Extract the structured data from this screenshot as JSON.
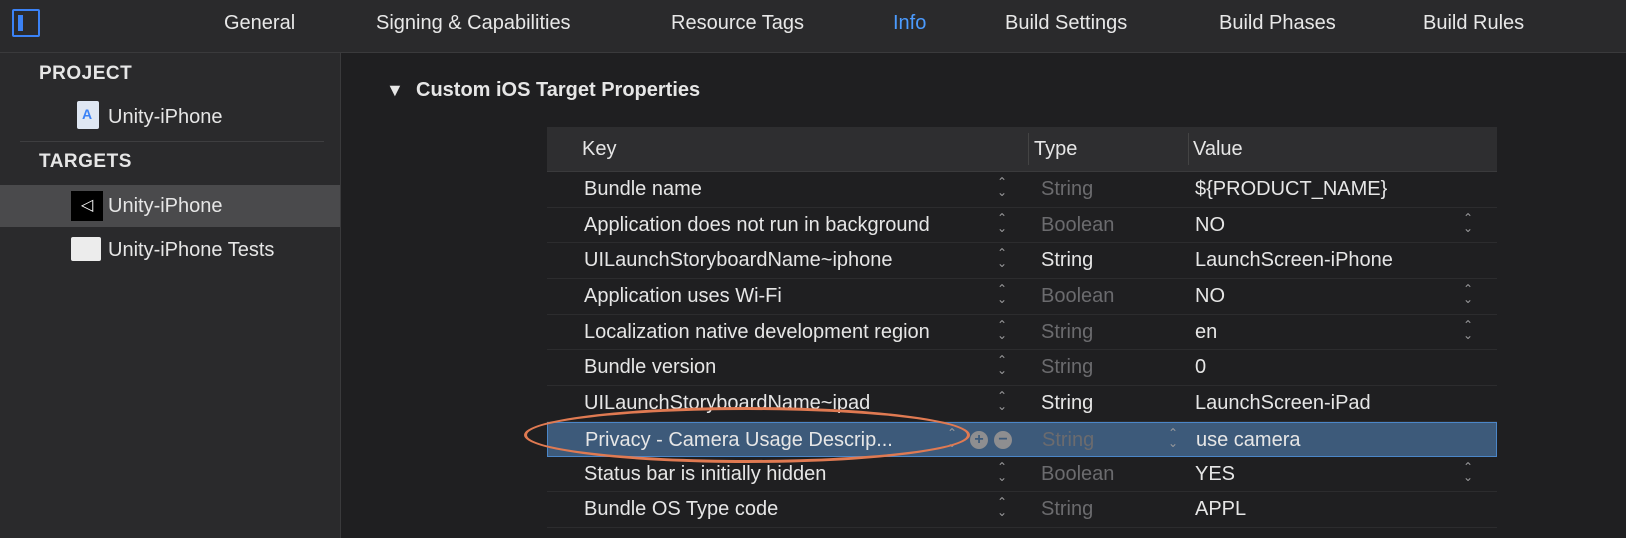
{
  "tabs": [
    {
      "label": "General",
      "active": false
    },
    {
      "label": "Signing & Capabilities",
      "active": false
    },
    {
      "label": "Resource Tags",
      "active": false
    },
    {
      "label": "Info",
      "active": true
    },
    {
      "label": "Build Settings",
      "active": false
    },
    {
      "label": "Build Phases",
      "active": false
    },
    {
      "label": "Build Rules",
      "active": false
    }
  ],
  "sidebar": {
    "project_header": "PROJECT",
    "project_item": "Unity-iPhone",
    "targets_header": "TARGETS",
    "targets": [
      {
        "label": "Unity-iPhone",
        "selected": true,
        "icon": "unity-icon"
      },
      {
        "label": "Unity-iPhone Tests",
        "selected": false,
        "icon": "test-bundle-icon"
      }
    ]
  },
  "section": {
    "title": "Custom iOS Target Properties",
    "disclosure": "▼"
  },
  "table": {
    "headers": {
      "key": "Key",
      "type": "Type",
      "value": "Value"
    },
    "rows": [
      {
        "key": "Bundle name",
        "type": "String",
        "type_dim": true,
        "value": "${PRODUCT_NAME}",
        "value_stepper": false,
        "selected": false
      },
      {
        "key": "Application does not run in background",
        "type": "Boolean",
        "type_dim": true,
        "value": "NO",
        "value_stepper": true,
        "selected": false
      },
      {
        "key": "UILaunchStoryboardName~iphone",
        "type": "String",
        "type_dim": false,
        "value": "LaunchScreen-iPhone",
        "value_stepper": false,
        "selected": false
      },
      {
        "key": "Application uses Wi-Fi",
        "type": "Boolean",
        "type_dim": true,
        "value": "NO",
        "value_stepper": true,
        "selected": false
      },
      {
        "key": "Localization native development region",
        "type": "String",
        "type_dim": true,
        "value": "en",
        "value_stepper": true,
        "selected": false
      },
      {
        "key": "Bundle version",
        "type": "String",
        "type_dim": true,
        "value": "0",
        "value_stepper": false,
        "selected": false
      },
      {
        "key": "UILaunchStoryboardName~ipad",
        "type": "String",
        "type_dim": false,
        "value": "LaunchScreen-iPad",
        "value_stepper": false,
        "selected": false
      },
      {
        "key": "Privacy - Camera Usage Descrip...",
        "type": "String",
        "type_dim": true,
        "value": "use camera",
        "value_stepper": false,
        "selected": true
      },
      {
        "key": "Status bar is initially hidden",
        "type": "Boolean",
        "type_dim": true,
        "value": "YES",
        "value_stepper": true,
        "selected": false
      },
      {
        "key": "Bundle OS Type code",
        "type": "String",
        "type_dim": true,
        "value": "APPL",
        "value_stepper": false,
        "selected": false
      }
    ]
  },
  "row_buttons": {
    "add": "+",
    "remove": "−"
  },
  "colors": {
    "accent": "#4b9bff",
    "selection": "#3d5a7a",
    "annotation": "#e07a52"
  }
}
